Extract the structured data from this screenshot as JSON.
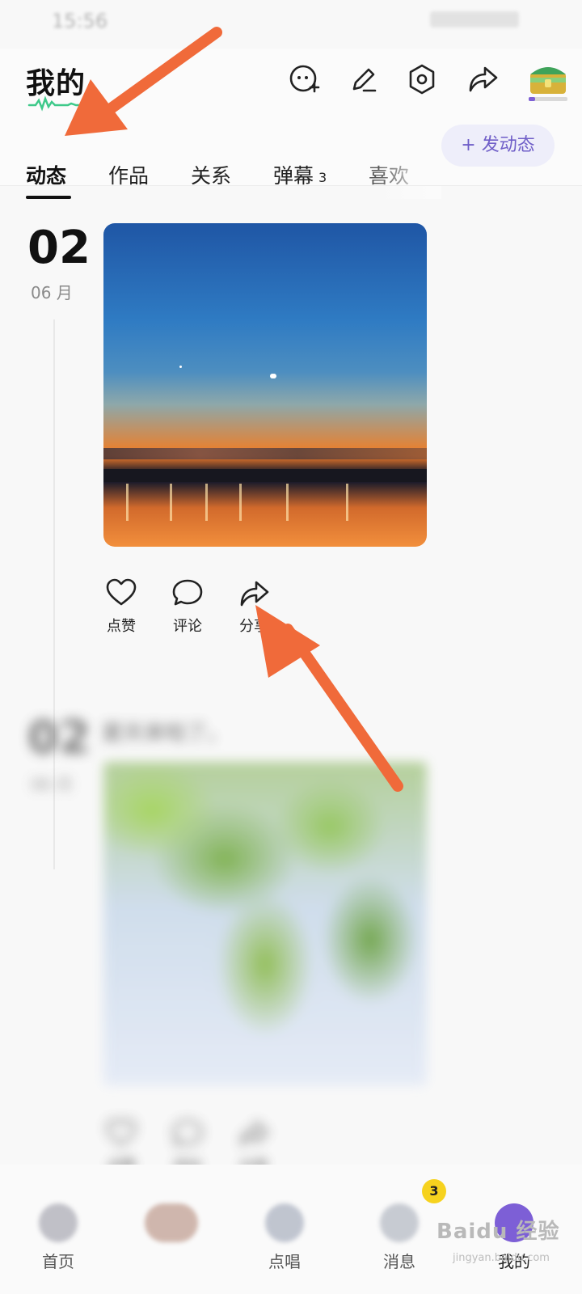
{
  "status_bar": {
    "time": "15:56"
  },
  "header": {
    "title": "我的",
    "icons": [
      "chat-add-icon",
      "edit-icon",
      "settings-icon",
      "share-icon",
      "treasure-chest-icon"
    ]
  },
  "tabs": {
    "items": [
      {
        "label": "动态",
        "active": true
      },
      {
        "label": "作品"
      },
      {
        "label": "关系"
      },
      {
        "label": "弹幕",
        "badge": "3"
      },
      {
        "label": "喜欢"
      }
    ],
    "post_button": "+ 发动态"
  },
  "feed": {
    "post1": {
      "day": "02",
      "month": "06 月",
      "actions": {
        "like": "点赞",
        "comment": "评论",
        "share": "分享"
      }
    },
    "post2": {
      "day": "02",
      "month": "06 月",
      "caption": "夏天来啦了。",
      "actions": {
        "like": "点赞",
        "comment": "评论",
        "share": "分享"
      }
    }
  },
  "tabbar": {
    "items": [
      {
        "label": "首页"
      },
      {
        "label": ""
      },
      {
        "label": "点唱"
      },
      {
        "label": "消息",
        "badge": "3"
      },
      {
        "label": "我的",
        "active": true
      }
    ]
  },
  "watermark": {
    "text": "Baidu 经验",
    "sub": "jingyan.baidu.com"
  },
  "colors": {
    "accent": "#6f5ec8",
    "annotation_arrow": "#f06a3a",
    "badge": "#f6d21e"
  }
}
